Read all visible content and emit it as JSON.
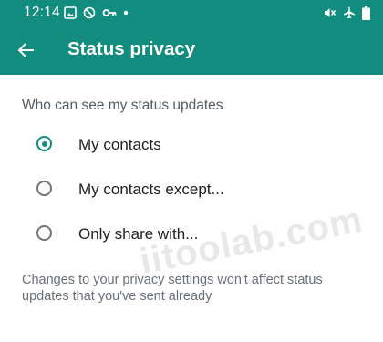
{
  "status_bar": {
    "time": "12:14",
    "left_icons": [
      "image-icon",
      "disabled-icon",
      "key-icon",
      "notification-dot-icon"
    ],
    "right_icons": [
      "vibrate-mute-icon",
      "airplane-icon",
      "battery-icon"
    ]
  },
  "app_bar": {
    "title": "Status privacy",
    "back_icon": "arrow-back-icon",
    "color": "#128c7e"
  },
  "section": {
    "header": "Who can see my status updates"
  },
  "options": [
    {
      "label": "My contacts",
      "selected": true
    },
    {
      "label": "My contacts except...",
      "selected": false
    },
    {
      "label": "Only share with...",
      "selected": false
    }
  ],
  "footer_note": "Changes to your privacy settings won't affect status updates that you've sent already",
  "watermark": "iitoolab.com",
  "colors": {
    "accent": "#128c7e",
    "primary_text": "#202124",
    "secondary_text": "#555b60",
    "radio_unselected": "#757575"
  }
}
